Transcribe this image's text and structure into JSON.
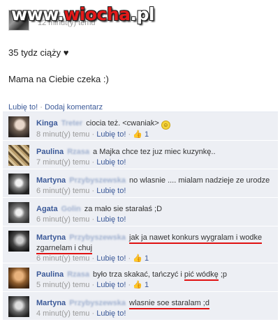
{
  "watermark": {
    "prefix": "www.",
    "brand": "wiocha",
    "suffix": ".pl"
  },
  "post": {
    "meta": "12 minut(y) temu",
    "line1": "35 tydz ciąży ♥",
    "line2": "Mama na Ciebie czeka :)"
  },
  "actions": {
    "like": "Lubię to!",
    "separator": " · ",
    "comment": "Dodaj komentarz"
  },
  "comments": [
    {
      "name": "Kinga",
      "surname": "Treter",
      "text": "ciocia też. <cwaniak>",
      "time": "8 minut(y) temu",
      "like": "Lubię to!",
      "likes": "1"
    },
    {
      "name": "Paulina",
      "surname": "Rzasa",
      "text": "a Majka chce tez juz miec kuzynkę..",
      "time": "7 minut(y) temu",
      "like": "Lubię to!"
    },
    {
      "name": "Martyna",
      "surname": "Przybyszewska",
      "text": "no wlasnie .... mialam nadzieje ze urodze",
      "time": "6 minut(y) temu",
      "like": "Lubię to!"
    },
    {
      "name": "Agata",
      "surname": "Golin",
      "text": "za mało sie starałaś ;D",
      "time": "6 minut(y) temu",
      "like": "Lubię to!"
    },
    {
      "name": "Martyna",
      "surname": "Przybyszewska",
      "text_a": "jak ja nawet konkurs wygralam i wodke",
      "text_b": "zgarnelam i chuj",
      "time": "6 minut(y) temu",
      "like": "Lubię to!",
      "likes": "1"
    },
    {
      "name": "Paulina",
      "surname": "Rzasa",
      "text_a": "było trza skakać, tańczyć i ",
      "text_b": "pić wódkę",
      "text_c": " ;p",
      "time": "5 minut(y) temu",
      "like": "Lubię to!",
      "likes": "1"
    },
    {
      "name": "Martyna",
      "surname": "Przybyszewska",
      "text": "wlasnie soe staralam ;d",
      "time": "4 minut(y) temu",
      "like": "Lubię to!"
    }
  ],
  "meta_sep": " · ",
  "colors": {
    "link": "#3b5998",
    "comment_bg": "#edeff4",
    "underline": "#e01010"
  }
}
